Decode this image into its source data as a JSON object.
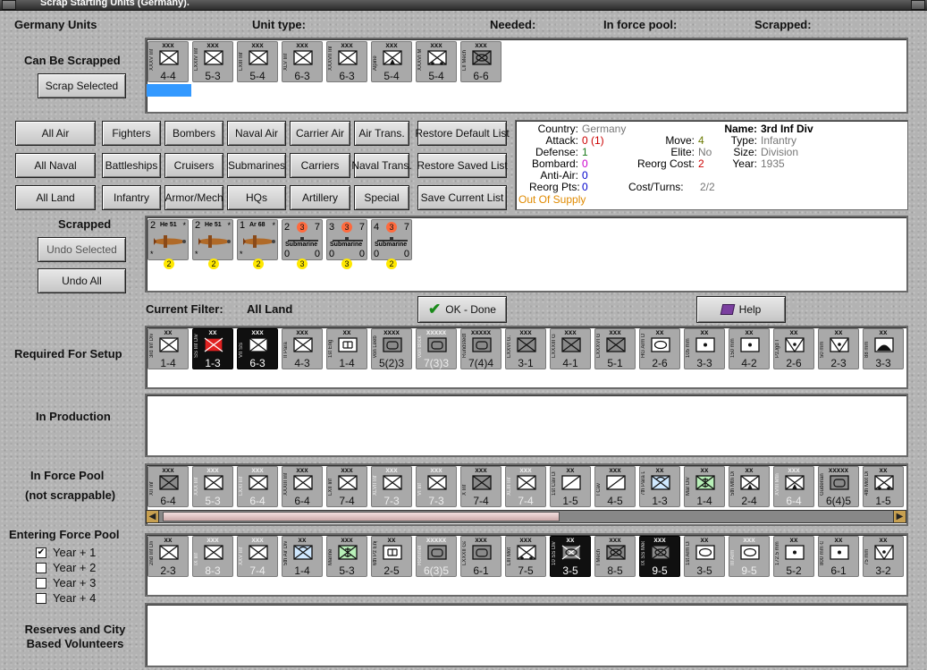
{
  "window": {
    "title": "Scrap Starting Units (Germany)."
  },
  "header": {
    "country_units": "Germany Units",
    "unit_type": "Unit type:",
    "needed": "Needed:",
    "in_force_pool": "In force pool:",
    "scrapped": "Scrapped:"
  },
  "sections": {
    "can_be_scrapped": "Can Be Scrapped",
    "scrapped": "Scrapped",
    "current_filter_label": "Current Filter:",
    "current_filter_value": "All Land",
    "required": "Required For Setup",
    "in_production": "In Production",
    "in_force_pool": "In Force Pool",
    "not_scrappable": "(not scrappable)",
    "entering": "Entering Force Pool",
    "reserves": "Reserves and City Based Volunteers"
  },
  "buttons": {
    "scrap_selected": "Scrap Selected",
    "undo_selected": "Undo Selected",
    "undo_all": "Undo All",
    "ok_done": "OK - Done",
    "help": "Help"
  },
  "filters": [
    [
      "All Air",
      "Fighters",
      "Bombers",
      "Naval Air",
      "Carrier Air",
      "Air Trans.",
      "Restore Default List"
    ],
    [
      "All Naval",
      "Battleships",
      "Cruisers",
      "Submarines",
      "Carriers",
      "Naval Trans.",
      "Restore Saved List"
    ],
    [
      "All Land",
      "Infantry",
      "Armor/Mech",
      "HQs",
      "Artillery",
      "Special",
      "Save Current List"
    ]
  ],
  "unit_info": {
    "country_label": "Country:",
    "country": "Germany",
    "attack_label": "Attack:",
    "attack": "0 (1)",
    "defense_label": "Defense:",
    "defense": "1",
    "bombard_label": "Bombard:",
    "bombard": "0",
    "antiair_label": "Anti-Air:",
    "antiair": "0",
    "reorg_pts_label": "Reorg Pts:",
    "reorg_pts": "0",
    "supply": "Out Of Supply",
    "name_label": "Name:",
    "name": "3rd Inf Div",
    "move_label": "Move:",
    "move": "4",
    "type_label": "Type:",
    "type": "Infantry",
    "elite_label": "Elite:",
    "elite": "No",
    "size_label": "Size:",
    "size": "Division",
    "reorg_cost_label": "Reorg Cost:",
    "reorg_cost": "2",
    "year_label": "Year:",
    "year": "1935",
    "cost_turns_label": "Cost/Turns:",
    "cost_turns": "2/2"
  },
  "entering_years": [
    {
      "label": "Year + 1",
      "checked": true
    },
    {
      "label": "Year + 2",
      "checked": false
    },
    {
      "label": "Year + 3",
      "checked": false
    },
    {
      "label": "Year + 4",
      "checked": false
    }
  ],
  "colors": {
    "attack_red": "#cc0000",
    "defense_green": "#1a7a1a",
    "bombard_magenta": "#cc00cc",
    "antiair_blue": "#0000cc",
    "reorg_red": "#cc0000",
    "supply_orange": "#e08a00",
    "info_gray": "#666666",
    "move_olive": "#6a7a00",
    "selection_blue": "#3399ff"
  },
  "can_be_scrapped_units": [
    {
      "size": "xxx",
      "name": "XXXV Inf",
      "sym": "inf",
      "stats": "4-4",
      "sel": true
    },
    {
      "size": "xxx",
      "name": "LXXIV Inf",
      "sym": "inf",
      "stats": "5-3"
    },
    {
      "size": "xxx",
      "name": "LXIII Inf",
      "sym": "inf",
      "stats": "5-4"
    },
    {
      "size": "xxx",
      "name": "XLV Inf",
      "sym": "inf",
      "stats": "6-3"
    },
    {
      "size": "xxx",
      "name": "XXXVII Inf",
      "sym": "inf",
      "stats": "6-3"
    },
    {
      "size": "xxx",
      "name": "Alpine",
      "sym": "mtn",
      "stats": "5-4"
    },
    {
      "size": "xxx",
      "name": "XXXVI M",
      "sym": "mot",
      "stats": "5-4"
    },
    {
      "size": "xxx",
      "name": "LII Mech",
      "sym": "mech",
      "stats": "6-6"
    }
  ],
  "scrapped_units": [
    {
      "kind": "air",
      "type": "He 51",
      "l": "2",
      "r": "*",
      "circ": "2"
    },
    {
      "kind": "air",
      "type": "He 51",
      "l": "2",
      "r": "*",
      "circ": "2"
    },
    {
      "kind": "air",
      "type": "Ar 68",
      "l": "1",
      "r": "*",
      "circ": "2"
    },
    {
      "kind": "sub",
      "l": "2",
      "mid": "3",
      "r": "7",
      "bl": "0",
      "bm": "3",
      "br": "0"
    },
    {
      "kind": "sub",
      "l": "3",
      "mid": "3",
      "r": "7",
      "bl": "0",
      "bm": "3",
      "br": "0"
    },
    {
      "kind": "sub",
      "l": "4",
      "mid": "3",
      "r": "7",
      "bl": "0",
      "bm": "2",
      "br": "0"
    }
  ],
  "required_units": [
    {
      "size": "xx",
      "name": "3rd Inf Div",
      "sym": "inf",
      "stats": "1-4"
    },
    {
      "size": "xx",
      "name": "SS Inf Div",
      "sym": "inf",
      "stats": "1-3",
      "dark": true,
      "red": true
    },
    {
      "size": "xxx",
      "name": "VII SS",
      "sym": "inf",
      "stats": "6-3",
      "dark": true
    },
    {
      "size": "xxx",
      "name": "II Para",
      "sym": "inf",
      "stats": "4-3"
    },
    {
      "size": "xx",
      "name": "1st Eng",
      "sym": "eng",
      "stats": "1-4"
    },
    {
      "size": "xxxx",
      "name": "von Leeb",
      "sym": "hq",
      "stats": "5(2)3"
    },
    {
      "size": "xxxxx",
      "name": "von Bock",
      "sym": "hq",
      "stats": "7(3)3",
      "fade": true
    },
    {
      "size": "xxxxx",
      "name": "Rundstedt",
      "sym": "hq",
      "stats": "7(4)4"
    },
    {
      "size": "xxx",
      "name": "LXXVI G.",
      "sym": "gar",
      "stats": "3-1"
    },
    {
      "size": "xxx",
      "name": "LXXXIII Ga.",
      "sym": "gar",
      "stats": "4-1"
    },
    {
      "size": "xxx",
      "name": "LXXXVI Ga.",
      "sym": "gar",
      "stats": "5-1"
    },
    {
      "size": "xx",
      "name": "HG Arm Div",
      "sym": "arm",
      "stats": "2-6"
    },
    {
      "size": "xx",
      "name": "105 mm",
      "sym": "art",
      "stats": "3-3"
    },
    {
      "size": "xx",
      "name": "150 mm",
      "sym": "art",
      "stats": "4-2"
    },
    {
      "size": "xx",
      "name": "PzJgd I",
      "sym": "at",
      "stats": "2-6"
    },
    {
      "size": "xx",
      "name": "50 mm",
      "sym": "at",
      "stats": "2-3"
    },
    {
      "size": "xx",
      "name": "88 mm",
      "sym": "aa",
      "stats": "3-3"
    }
  ],
  "force_pool_units": [
    {
      "size": "xxx",
      "name": "XII Inf",
      "sym": "gar",
      "stats": "6-4"
    },
    {
      "size": "xxx",
      "name": "XXX Inf",
      "sym": "inf",
      "stats": "5-3",
      "fade": true
    },
    {
      "size": "xxx",
      "name": "LXXI Inf",
      "sym": "inf",
      "stats": "6-4",
      "fade": true
    },
    {
      "size": "xxx",
      "name": "XXXIII Inf",
      "sym": "inf",
      "stats": "6-4"
    },
    {
      "size": "xxx",
      "name": "LXII Inf",
      "sym": "inf",
      "stats": "7-4"
    },
    {
      "size": "xxx",
      "name": "XLVII Inf",
      "sym": "inf",
      "stats": "7-3",
      "fade": true
    },
    {
      "size": "xxx",
      "name": "VI Inf",
      "sym": "inf",
      "stats": "7-3",
      "fade": true
    },
    {
      "size": "xxx",
      "name": "X Inf",
      "sym": "gar",
      "stats": "7-4"
    },
    {
      "size": "xxx",
      "name": "XLIII Inf",
      "sym": "inf",
      "stats": "7-4",
      "fade": true
    },
    {
      "size": "xx",
      "name": "1st Cav Div",
      "sym": "cav",
      "stats": "1-5"
    },
    {
      "size": "xxx",
      "name": "I Cav",
      "sym": "cav",
      "stats": "4-5"
    },
    {
      "size": "xx",
      "name": "7th Para Div",
      "sym": "para",
      "stats": "1-3"
    },
    {
      "size": "xx",
      "name": "Mar Div",
      "sym": "mar",
      "stats": "1-4"
    },
    {
      "size": "xx",
      "name": "5th Mtn Div",
      "sym": "mtn",
      "stats": "2-4"
    },
    {
      "size": "xxx",
      "name": "XVIII Mtn",
      "sym": "mtn",
      "stats": "6-4",
      "fade": true
    },
    {
      "size": "xxxxx",
      "name": "Guderian",
      "sym": "hq",
      "stats": "6(4)5"
    },
    {
      "size": "xx",
      "name": "4th Mot Div",
      "sym": "mot",
      "stats": "1-5"
    }
  ],
  "entering_units": [
    {
      "size": "xx",
      "name": "2nd Inf Div",
      "sym": "inf",
      "stats": "2-3"
    },
    {
      "size": "xxx",
      "name": "IX Inf",
      "sym": "inf",
      "stats": "8-3",
      "fade": true
    },
    {
      "size": "xxx",
      "name": "XXV Inf",
      "sym": "inf",
      "stats": "7-4",
      "fade": true
    },
    {
      "size": "xx",
      "name": "5th Air Div",
      "sym": "para",
      "stats": "1-4"
    },
    {
      "size": "xxx",
      "name": "Marine",
      "sym": "mar",
      "stats": "5-3"
    },
    {
      "size": "xx",
      "name": "6th Pz Eng",
      "sym": "eng",
      "stats": "2-5"
    },
    {
      "size": "xxxxx",
      "name": "Rommel",
      "sym": "hq",
      "stats": "6(3)5",
      "fade": true
    },
    {
      "size": "xxx",
      "name": "LXXXII Garr",
      "sym": "hq",
      "stats": "6-1"
    },
    {
      "size": "xxx",
      "name": "LIII Mot",
      "sym": "mot",
      "stats": "7-5"
    },
    {
      "size": "xx",
      "name": "10 SS Div",
      "sym": "mech",
      "stats": "3-5",
      "dark": true,
      "red": true
    },
    {
      "size": "xxx",
      "name": "I Mech",
      "sym": "mech",
      "stats": "8-5"
    },
    {
      "size": "xxx",
      "name": "IX SS Mech",
      "sym": "mech",
      "stats": "9-5",
      "dark": true
    },
    {
      "size": "xx",
      "name": "1st Arm Div",
      "sym": "arm",
      "stats": "3-5"
    },
    {
      "size": "xxx",
      "name": "III Arm",
      "sym": "arm",
      "stats": "9-5",
      "fade": true
    },
    {
      "size": "xx",
      "name": "172.5 mm",
      "sym": "art",
      "stats": "5-2"
    },
    {
      "size": "xx",
      "name": "800 mm G.",
      "sym": "art",
      "stats": "6-1"
    },
    {
      "size": "xx",
      "name": "75 mm",
      "sym": "at",
      "stats": "3-2"
    }
  ]
}
